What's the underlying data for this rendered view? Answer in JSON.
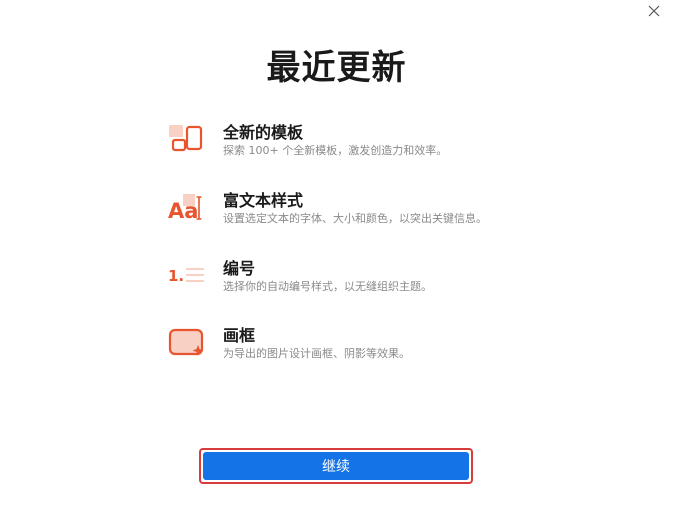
{
  "dialog": {
    "title": "最近更新",
    "close_icon": "close-icon"
  },
  "features": [
    {
      "icon": "templates-icon",
      "title": "全新的模板",
      "description": "探索 100+ 个全新模板，激发创造力和效率。"
    },
    {
      "icon": "rich-text-icon",
      "title": "富文本样式",
      "description": "设置选定文本的字体、大小和颜色，以突出关键信息。"
    },
    {
      "icon": "numbering-icon",
      "title": "编号",
      "description": "选择你的自动编号样式，以无缝组织主题。"
    },
    {
      "icon": "frame-icon",
      "title": "画框",
      "description": "为导出的图片设计画框、阴影等效果。"
    }
  ],
  "footer": {
    "continue_label": "继续"
  },
  "colors": {
    "accent": "#e8552e",
    "accent_light": "#f8d0c4",
    "primary_button": "#1473e6",
    "highlight_border": "#d93a3a"
  },
  "icon_text": {
    "rich_text_glyph": "Aa",
    "numbering_glyph": "1."
  }
}
